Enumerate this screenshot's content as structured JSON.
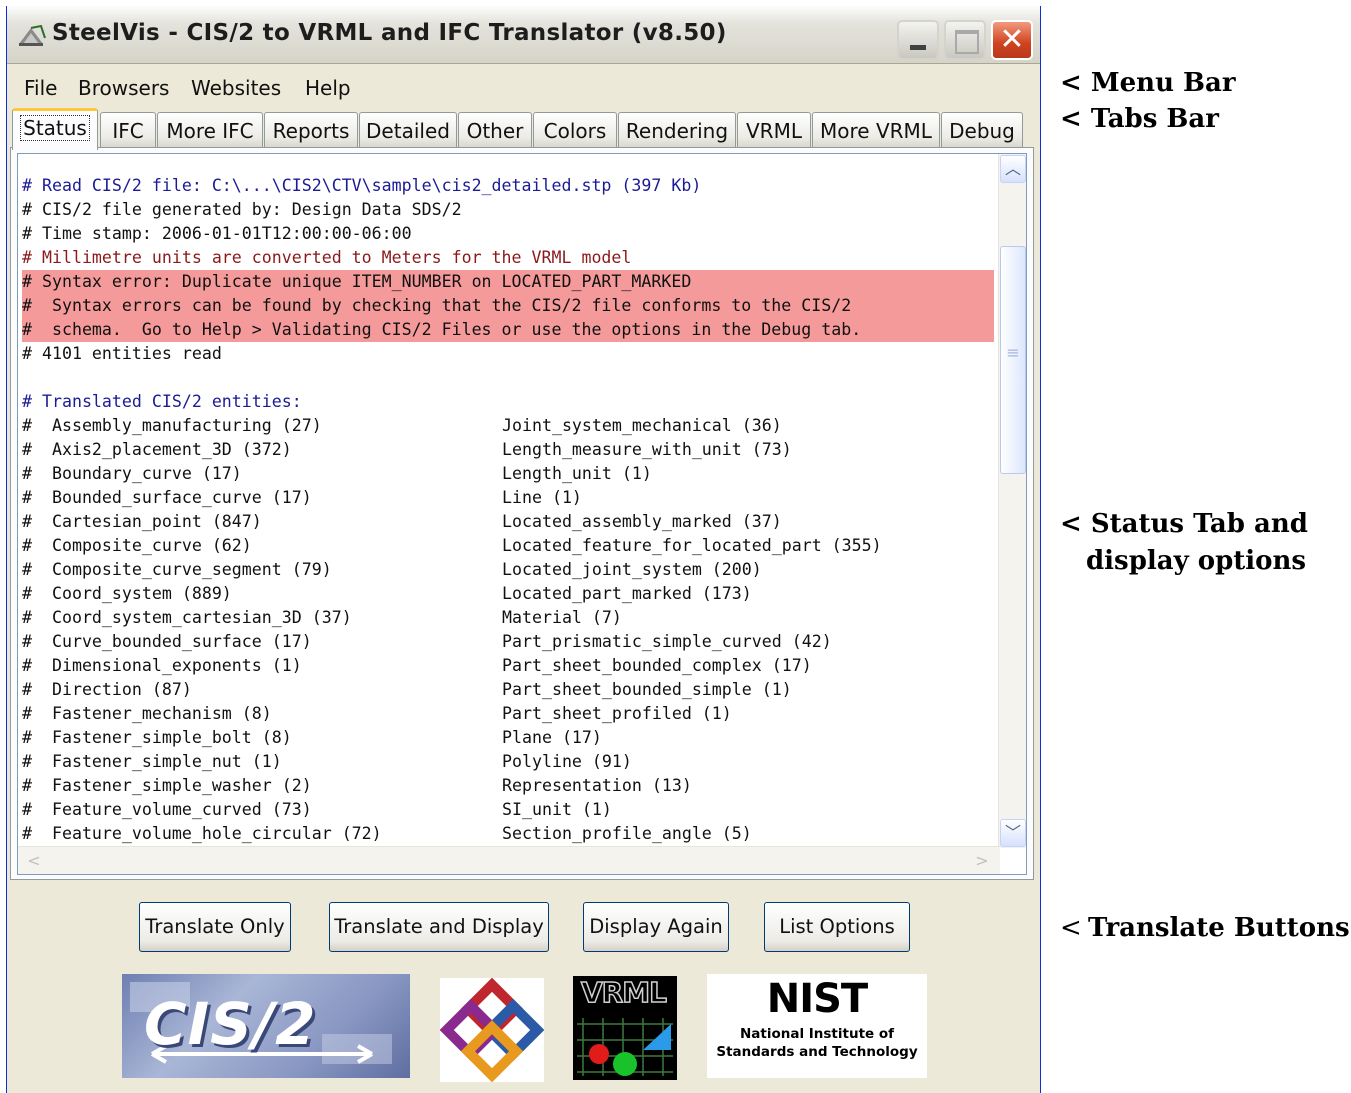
{
  "window": {
    "title": "SteelVis - CIS/2 to VRML and IFC Translator  (v8.50)"
  },
  "menu": [
    "File",
    "Browsers",
    "Websites",
    "Help"
  ],
  "tabs": [
    "Status",
    "IFC",
    "More IFC",
    "Reports",
    "Detailed",
    "Other",
    "Colors",
    "Rendering",
    "VRML",
    "More VRML",
    "Debug"
  ],
  "active_tab": "Status",
  "status_text": {
    "header_lines": [
      {
        "text": "# Read CIS/2 file: C:\\...\\CIS2\\CTV\\sample\\cis2_detailed.stp (397 Kb)",
        "style": "blue"
      },
      {
        "text": "# CIS/2 file generated by: Design Data SDS/2",
        "style": "plain"
      },
      {
        "text": "# Time stamp: 2006-01-01T12:00:00-06:00",
        "style": "plain"
      },
      {
        "text": "# Millimetre units are converted to Meters for the VRML model",
        "style": "red"
      },
      {
        "text": "# Syntax error: Duplicate unique ITEM_NUMBER on LOCATED_PART_MARKED",
        "style": "err"
      },
      {
        "text": "#  Syntax errors can be found by checking that the CIS/2 file conforms to the CIS/2",
        "style": "err"
      },
      {
        "text": "#  schema.  Go to Help > Validating CIS/2 Files or use the options in the Debug tab.",
        "style": "err"
      },
      {
        "text": "# 4101 entities read",
        "style": "plain"
      },
      {
        "text": "",
        "style": "plain"
      },
      {
        "text": "# Translated CIS/2 entities:",
        "style": "blue"
      }
    ],
    "entity_rows": [
      {
        "left": "#  Assembly_manufacturing (27)",
        "right": "Joint_system_mechanical (36)"
      },
      {
        "left": "#  Axis2_placement_3D (372)",
        "right": "Length_measure_with_unit (73)"
      },
      {
        "left": "#  Boundary_curve (17)",
        "right": "Length_unit (1)"
      },
      {
        "left": "#  Bounded_surface_curve (17)",
        "right": "Line (1)"
      },
      {
        "left": "#  Cartesian_point (847)",
        "right": "Located_assembly_marked (37)"
      },
      {
        "left": "#  Composite_curve (62)",
        "right": "Located_feature_for_located_part (355)"
      },
      {
        "left": "#  Composite_curve_segment (79)",
        "right": "Located_joint_system (200)"
      },
      {
        "left": "#  Coord_system (889)",
        "right": "Located_part_marked (173)"
      },
      {
        "left": "#  Coord_system_cartesian_3D (37)",
        "right": "Material (7)"
      },
      {
        "left": "#  Curve_bounded_surface (17)",
        "right": "Part_prismatic_simple_curved (42)"
      },
      {
        "left": "#  Dimensional_exponents (1)",
        "right": "Part_sheet_bounded_complex (17)"
      },
      {
        "left": "#  Direction (87)",
        "right": "Part_sheet_bounded_simple (1)"
      },
      {
        "left": "#  Fastener_mechanism (8)",
        "right": "Part_sheet_profiled (1)"
      },
      {
        "left": "#  Fastener_simple_bolt (8)",
        "right": "Plane (17)"
      },
      {
        "left": "#  Fastener_simple_nut (1)",
        "right": "Polyline (91)"
      },
      {
        "left": "#  Fastener_simple_washer (2)",
        "right": "Representation (13)"
      },
      {
        "left": "#  Feature_volume_curved (73)",
        "right": "SI_unit (1)"
      },
      {
        "left": "#  Feature_volume_hole_circular (72)",
        "right": "Section_profile_angle (5)"
      }
    ]
  },
  "buttons": {
    "translate_only": "Translate Only",
    "translate_and_display": "Translate and Display",
    "display_again": "Display Again",
    "list_options": "List Options"
  },
  "logos": {
    "cis2": "CIS/2",
    "vrml": "VRML",
    "nist": "NIST",
    "nist_line1": "National Institute of",
    "nist_line2": "Standards and Technology"
  },
  "annotations": {
    "menu_bar": "< Menu Bar",
    "tabs_bar": "< Tabs Bar",
    "status_tab_line1": "< Status Tab and",
    "status_tab_line2": "display options",
    "translate_buttons_arrow": "<",
    "translate_buttons": "Translate Buttons"
  },
  "colors": {
    "error_highlight": "#f59a9a",
    "blue_text": "#1b1b96",
    "red_text": "#8b1a1a",
    "close_button": "#d0421f",
    "tab_active_accent": "#ffc83c"
  }
}
